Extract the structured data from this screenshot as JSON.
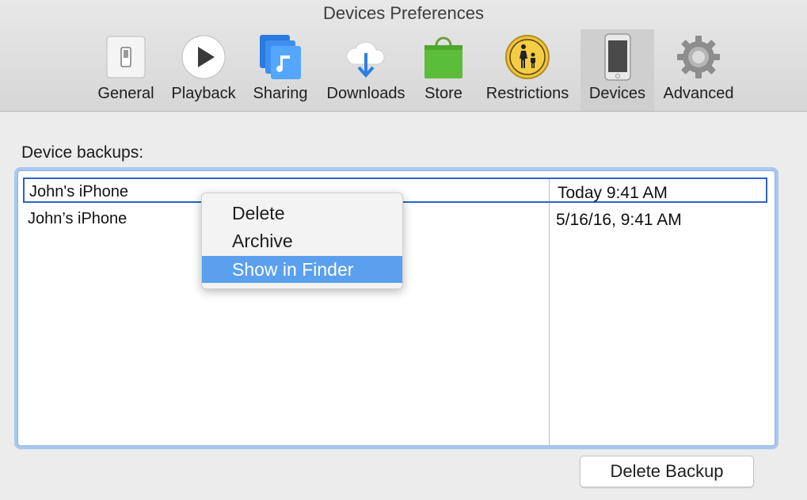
{
  "window": {
    "title": "Devices Preferences"
  },
  "toolbar": {
    "items": [
      {
        "label": "General",
        "icon": "switch-icon"
      },
      {
        "label": "Playback",
        "icon": "play-icon"
      },
      {
        "label": "Sharing",
        "icon": "music-share-icon"
      },
      {
        "label": "Downloads",
        "icon": "cloud-download-icon"
      },
      {
        "label": "Store",
        "icon": "shopping-bag-icon"
      },
      {
        "label": "Restrictions",
        "icon": "parental-icon"
      },
      {
        "label": "Devices",
        "icon": "phone-icon",
        "selected": true
      },
      {
        "label": "Advanced",
        "icon": "gear-icon"
      }
    ]
  },
  "backups": {
    "label": "Device backups:",
    "rows": [
      {
        "name": "John's iPhone",
        "date": "Today 9:41 AM",
        "selected": true
      },
      {
        "name": "John’s iPhone",
        "date": "5/16/16, 9:41 AM"
      }
    ]
  },
  "context_menu": {
    "items": [
      {
        "label": "Delete"
      },
      {
        "label": "Archive"
      },
      {
        "label": "Show in Finder",
        "highlighted": true
      }
    ]
  },
  "actions": {
    "delete_backup": "Delete Backup"
  },
  "colors": {
    "selection": "#2e63c7",
    "menu_highlight": "#5aa0ee",
    "focus_ring": "#a9c8ee"
  }
}
